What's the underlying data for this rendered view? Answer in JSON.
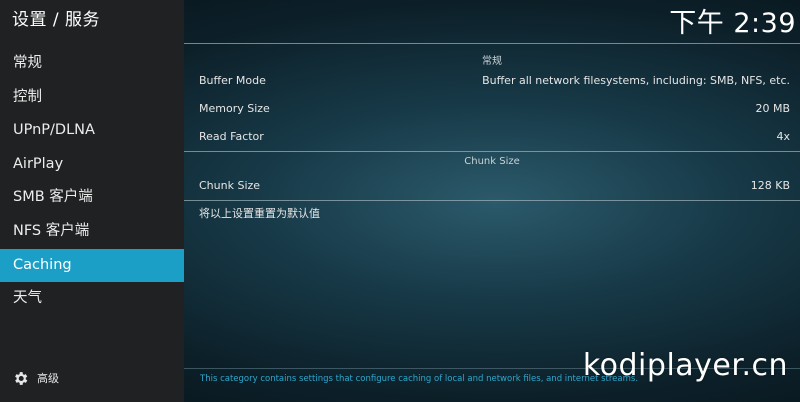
{
  "window_title": "设置 / 服务",
  "clock": "下午 2:39",
  "sidebar": {
    "items": [
      {
        "label": "常规"
      },
      {
        "label": "控制"
      },
      {
        "label": "UPnP/DLNA"
      },
      {
        "label": "AirPlay"
      },
      {
        "label": "SMB 客户端"
      },
      {
        "label": "NFS 客户端"
      },
      {
        "label": "Caching",
        "active": true
      },
      {
        "label": "天气"
      }
    ],
    "advanced_label": "高级"
  },
  "settings": {
    "section_general": "常规",
    "buffer_mode": {
      "label": "Buffer Mode",
      "value": "Buffer all network filesystems, including: SMB, NFS, etc."
    },
    "memory_size": {
      "label": "Memory Size",
      "value": "20 MB"
    },
    "read_factor": {
      "label": "Read Factor",
      "value": "4x"
    },
    "section_chunk": "Chunk Size",
    "chunk_size": {
      "label": "Chunk Size",
      "value": "128 KB"
    },
    "reset": {
      "label": "将以上设置重置为默认值"
    }
  },
  "description": "This category contains settings that configure caching of local and network files, and internet streams.",
  "watermark": "kodiplayer.cn",
  "colors": {
    "accent": "#1c9fc7",
    "sidebar_bg": "#1f2122",
    "description_text": "#2fa7cc"
  }
}
